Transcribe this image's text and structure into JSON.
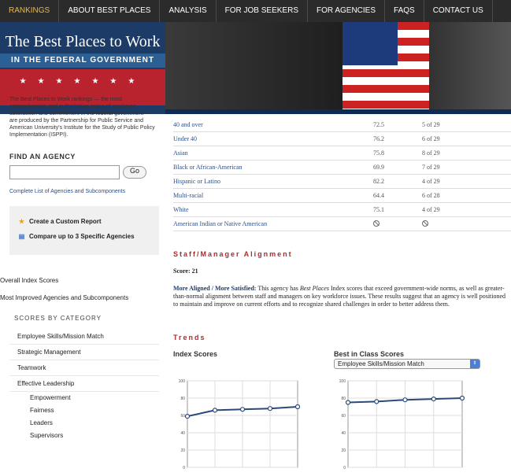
{
  "nav": {
    "items": [
      "RANKINGS",
      "ABOUT BEST PLACES",
      "ANALYSIS",
      "FOR JOB SEEKERS",
      "FOR AGENCIES",
      "FAQS",
      "CONTACT US"
    ],
    "active": "RANKINGS"
  },
  "logo": {
    "line1": "The Best Places to Work",
    "line2": "IN THE FEDERAL GOVERNMENT"
  },
  "intro": {
    "em": "Best Places to Work",
    "text": "The Best Places to Work rankings — the most comprehensive and authoritative rating of employee satisfaction and commitment in the federal government — are produced by the Partnership for Public Service and American University's Institute for the Study of Public Policy Implementation (ISPPI)."
  },
  "find": {
    "title": "FIND AN AGENCY",
    "input_value": "",
    "go_label": "Go",
    "complete_link": "Complete List of Agencies and Subcomponents"
  },
  "tools": {
    "custom_report": "Create a Custom Report",
    "compare": "Compare up to 3 Specific Agencies"
  },
  "side_links": {
    "overall": "Overall Index Scores",
    "improved": "Most Improved Agencies and Subcomponents"
  },
  "categories": {
    "title": "SCORES BY CATEGORY",
    "items": [
      "Employee Skills/Mission Match",
      "Strategic Management",
      "Teamwork",
      "Effective Leadership"
    ],
    "subitems": [
      "Empowerment",
      "Fairness",
      "Leaders",
      "Supervisors"
    ]
  },
  "table": {
    "rows": [
      {
        "label": "40 and over",
        "score": "72.5",
        "rank": "5 of 29"
      },
      {
        "label": "Under 40",
        "score": "76.2",
        "rank": "6 of 29"
      },
      {
        "label": "Asian",
        "score": "75.8",
        "rank": "8 of 29"
      },
      {
        "label": "Black or African-American",
        "score": "69.9",
        "rank": "7 of 29"
      },
      {
        "label": "Hispanic or Latino",
        "score": "82.2",
        "rank": "4 of 29"
      },
      {
        "label": "Multi-racial",
        "score": "64.4",
        "rank": "6 of 28"
      },
      {
        "label": "White",
        "score": "75.1",
        "rank": "4 of 29"
      },
      {
        "label": "American Indian or Native American",
        "score": "",
        "rank": ""
      }
    ]
  },
  "alignment": {
    "title": "Staff/Manager Alignment",
    "score_label": "Score: 21",
    "lead": "More Aligned / More Satisfied:",
    "text_before": " This agency has ",
    "text_em": "Best Places",
    "text_after": " Index scores that exceed government-wide norms, as well as greater-than-normal alignment between staff and managers on key workforce issues. These results suggest that an agency is well positioned to maintain and improve on current efforts and to recognize shared challenges in order to better address them."
  },
  "trends": {
    "title": "Trends",
    "index_title": "Index Scores",
    "best_title": "Best in Class Scores",
    "select_value": "Employee Skills/Mission Match"
  },
  "chart_data": [
    {
      "type": "line",
      "title": "Index Scores",
      "ylim": [
        0,
        100
      ],
      "yticks": [
        0,
        20,
        40,
        60,
        80,
        100
      ],
      "x": [
        1,
        2,
        3,
        4,
        5
      ],
      "values": [
        59,
        66,
        67,
        68,
        70
      ],
      "grid": true
    },
    {
      "type": "line",
      "title": "Best in Class Scores",
      "ylim": [
        0,
        100
      ],
      "yticks": [
        0,
        20,
        40,
        60,
        80,
        100
      ],
      "x": [
        1,
        2,
        3,
        4,
        5
      ],
      "values": [
        75,
        76,
        78,
        79,
        80
      ],
      "grid": true
    }
  ],
  "colors": {
    "nav_bg": "#2b2b2b",
    "nav_active": "#e8b84a",
    "link": "#2b4f8a",
    "section_red": "#b02a2a",
    "line": "#2c4a78"
  }
}
